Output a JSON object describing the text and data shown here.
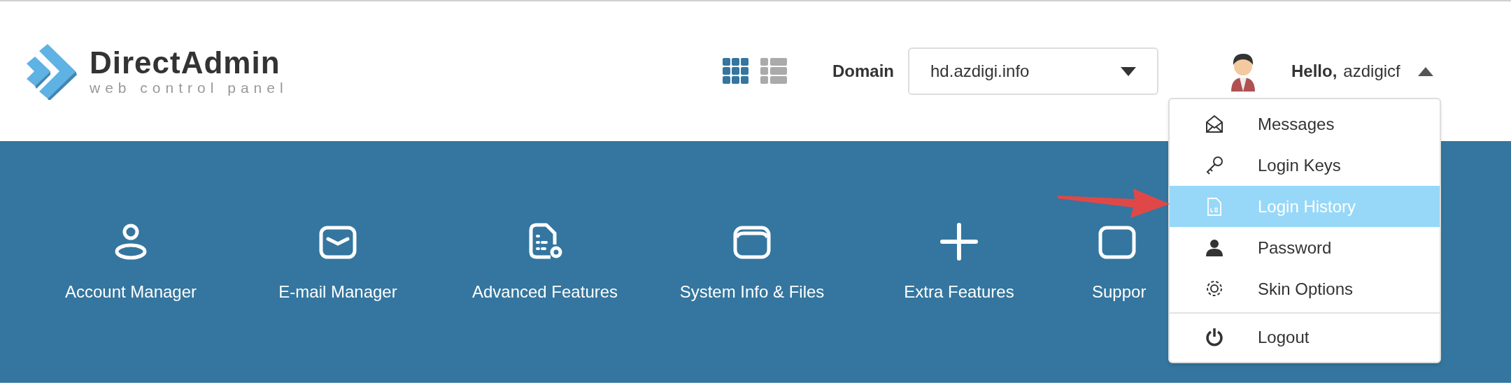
{
  "logo": {
    "name": "DirectAdmin",
    "tagline": "web control panel"
  },
  "view_toggle": [
    {
      "selected": true
    },
    {
      "selected": false
    }
  ],
  "domain": {
    "label": "Domain",
    "value": "hd.azdigi.info"
  },
  "user": {
    "greeting": "Hello,",
    "name": "azdigicf",
    "expanded": true
  },
  "user_menu": [
    {
      "label": "Messages",
      "selected": false,
      "kind": "link"
    },
    {
      "label": "Login Keys",
      "selected": false,
      "kind": "link"
    },
    {
      "label": "Login History",
      "selected": true,
      "kind": "link"
    },
    {
      "label": "Password",
      "selected": false,
      "kind": "link"
    },
    {
      "label": "Skin Options",
      "selected": false,
      "kind": "link"
    },
    {
      "label": "Logout",
      "selected": false,
      "kind": "action"
    }
  ],
  "nav": [
    {
      "label": "Account Manager"
    },
    {
      "label": "E-mail Manager"
    },
    {
      "label": "Advanced Features"
    },
    {
      "label": "System Info & Files"
    },
    {
      "label": "Extra Features"
    },
    {
      "label": "Suppor"
    }
  ]
}
